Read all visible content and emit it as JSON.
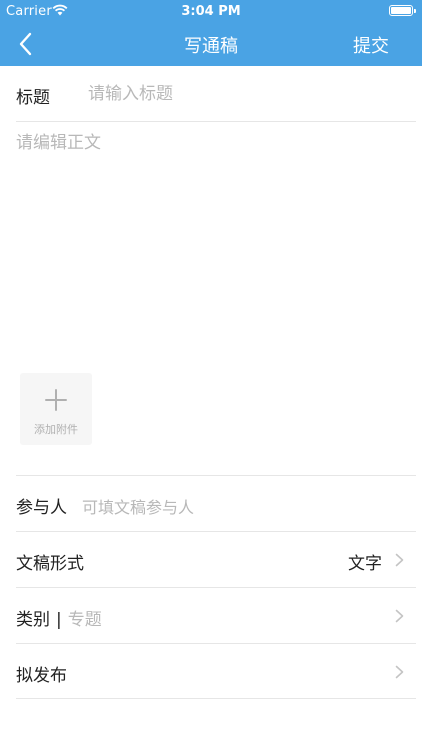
{
  "status_bar": {
    "carrier": "Carrier",
    "time": "3:04 PM"
  },
  "nav": {
    "title": "写通稿",
    "submit_label": "提交"
  },
  "form": {
    "title_label": "标题",
    "title_placeholder": "请输入标题",
    "body_placeholder": "请编辑正文",
    "attach_label": "添加附件"
  },
  "rows": {
    "participants": {
      "label": "参与人",
      "placeholder": "可填文稿参与人"
    },
    "format": {
      "label": "文稿形式",
      "value": "文字"
    },
    "category": {
      "label": "类别",
      "separator": "|",
      "value": "专题"
    },
    "publish": {
      "label": "拟发布"
    }
  },
  "colors": {
    "nav_bg": "#4aa3e4",
    "placeholder": "#b8b8b8",
    "divider": "#e6e6e6"
  },
  "icons": [
    "back-arrow-icon",
    "wifi-icon",
    "battery-icon",
    "plus-icon",
    "chevron-right-icon"
  ]
}
